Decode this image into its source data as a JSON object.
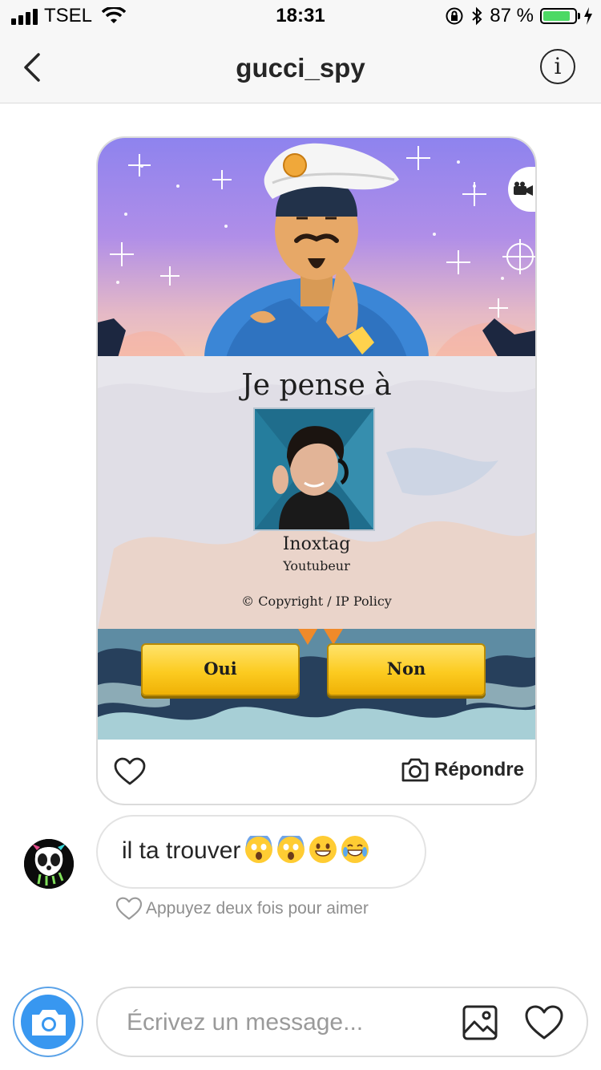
{
  "status_bar": {
    "carrier": "TSEL",
    "time": "18:31",
    "battery_percent": "87 %",
    "battery_level": 0.87
  },
  "header": {
    "title": "gucci_spy",
    "info_label": "i"
  },
  "shared_post": {
    "heading": "Je pense à",
    "character_name": "Inoxtag",
    "character_role": "Youtubeur",
    "copyright": "© Copyright / IP Policy",
    "yes_label": "Oui",
    "no_label": "Non",
    "reply_label": "Répondre"
  },
  "message": {
    "text": "il ta trouver",
    "emojis": [
      "face-screaming-in-fear",
      "face-screaming-in-fear",
      "grinning-face",
      "face-with-tears-of-joy"
    ]
  },
  "like_hint": "Appuyez deux fois pour aimer",
  "composer": {
    "placeholder": "Écrivez un message..."
  },
  "colors": {
    "accent": "#3897f0",
    "button_yellow": "#fccb20",
    "battery_green": "#4cd964"
  }
}
